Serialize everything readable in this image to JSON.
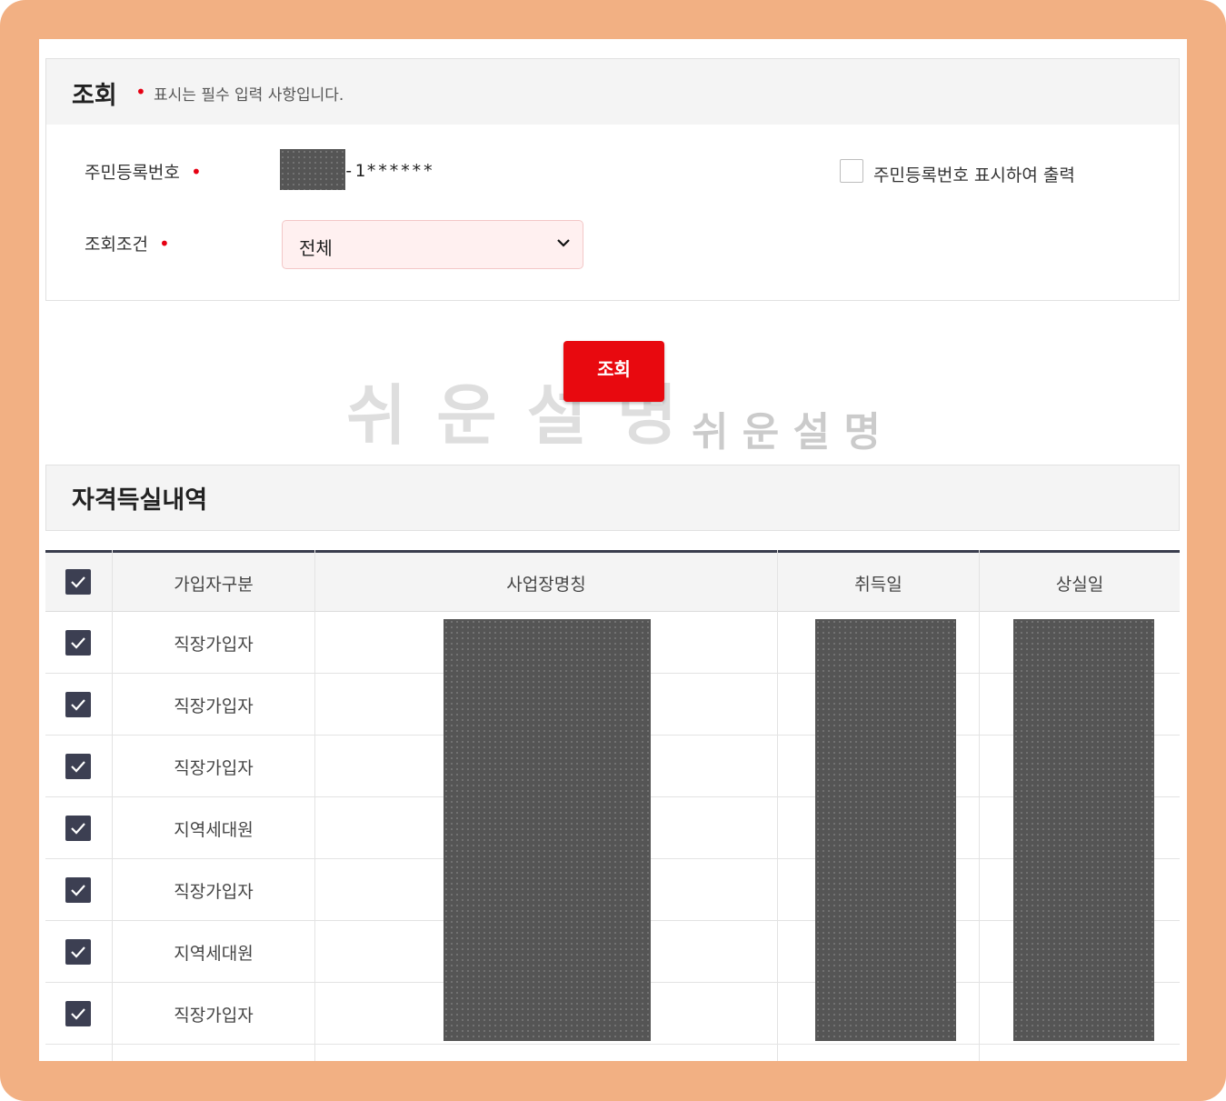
{
  "inquiry": {
    "title": "조회",
    "required_note": "표시는 필수 입력 사항입니다.",
    "rrn_label": "주민등록번호",
    "rrn_value_visible": "-1******",
    "rrn_display_checkbox_label": "주민등록번호 표시하여 출력",
    "rrn_display_checked": false,
    "condition_label": "조회조건",
    "condition_selected": "전체",
    "search_button": "조회"
  },
  "watermark": {
    "large": "쉬 운 설 명",
    "small": "쉬 운 설 명"
  },
  "history": {
    "title": "자격득실내역",
    "columns": [
      "가입자구분",
      "사업장명칭",
      "취득일",
      "상실일"
    ],
    "rows": [
      {
        "type": "직장가입자",
        "checked": true
      },
      {
        "type": "직장가입자",
        "checked": true
      },
      {
        "type": "직장가입자",
        "checked": true
      },
      {
        "type": "지역세대원",
        "checked": true
      },
      {
        "type": "직장가입자",
        "checked": true
      },
      {
        "type": "지역세대원",
        "checked": true
      },
      {
        "type": "직장가입자",
        "checked": true
      }
    ]
  },
  "colors": {
    "frame": "#f2b083",
    "required": "#e60012",
    "button": "#e8090f",
    "checkbox": "#3c3f52"
  }
}
